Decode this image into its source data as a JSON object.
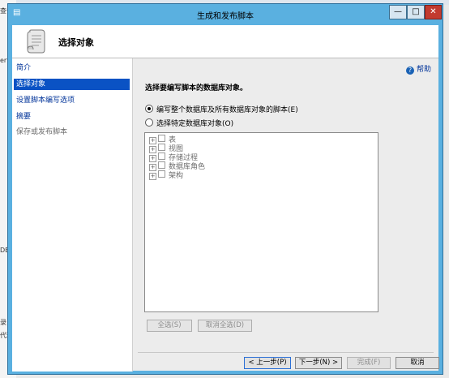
{
  "background": {
    "fragments": [
      "查询(",
      "erv",
      "DB",
      "录",
      "代理"
    ]
  },
  "window": {
    "title": "生成和发布脚本",
    "controls": {
      "minimize": "—",
      "maximize": "□",
      "close": "✕"
    }
  },
  "header": {
    "title": "选择对象"
  },
  "sidebar": {
    "items": [
      {
        "label": "简介",
        "state": "link"
      },
      {
        "label": "选择对象",
        "state": "selected"
      },
      {
        "label": "设置脚本编写选项",
        "state": "link"
      },
      {
        "label": "摘要",
        "state": "link"
      },
      {
        "label": "保存或发布脚本",
        "state": "disabled"
      }
    ]
  },
  "help": {
    "label": "帮助"
  },
  "main": {
    "heading": "选择要编写脚本的数据库对象。",
    "options": [
      {
        "label": "编写整个数据库及所有数据库对象的脚本(E)",
        "selected": true
      },
      {
        "label": "选择特定数据库对象(O)",
        "selected": false
      }
    ],
    "tree": [
      {
        "label": "表"
      },
      {
        "label": "视图"
      },
      {
        "label": "存储过程"
      },
      {
        "label": "数据库角色"
      },
      {
        "label": "架构"
      }
    ],
    "select_all": "全选(S)",
    "deselect_all": "取消全选(D)"
  },
  "footer": {
    "prev": "< 上一步(P)",
    "next": "下一步(N) >",
    "finish": "完成(F)",
    "cancel": "取消"
  },
  "colors": {
    "title_bar": "#5ab0e0",
    "selection": "#0a52c4",
    "link": "#003399",
    "close_button": "#c23a2f"
  }
}
